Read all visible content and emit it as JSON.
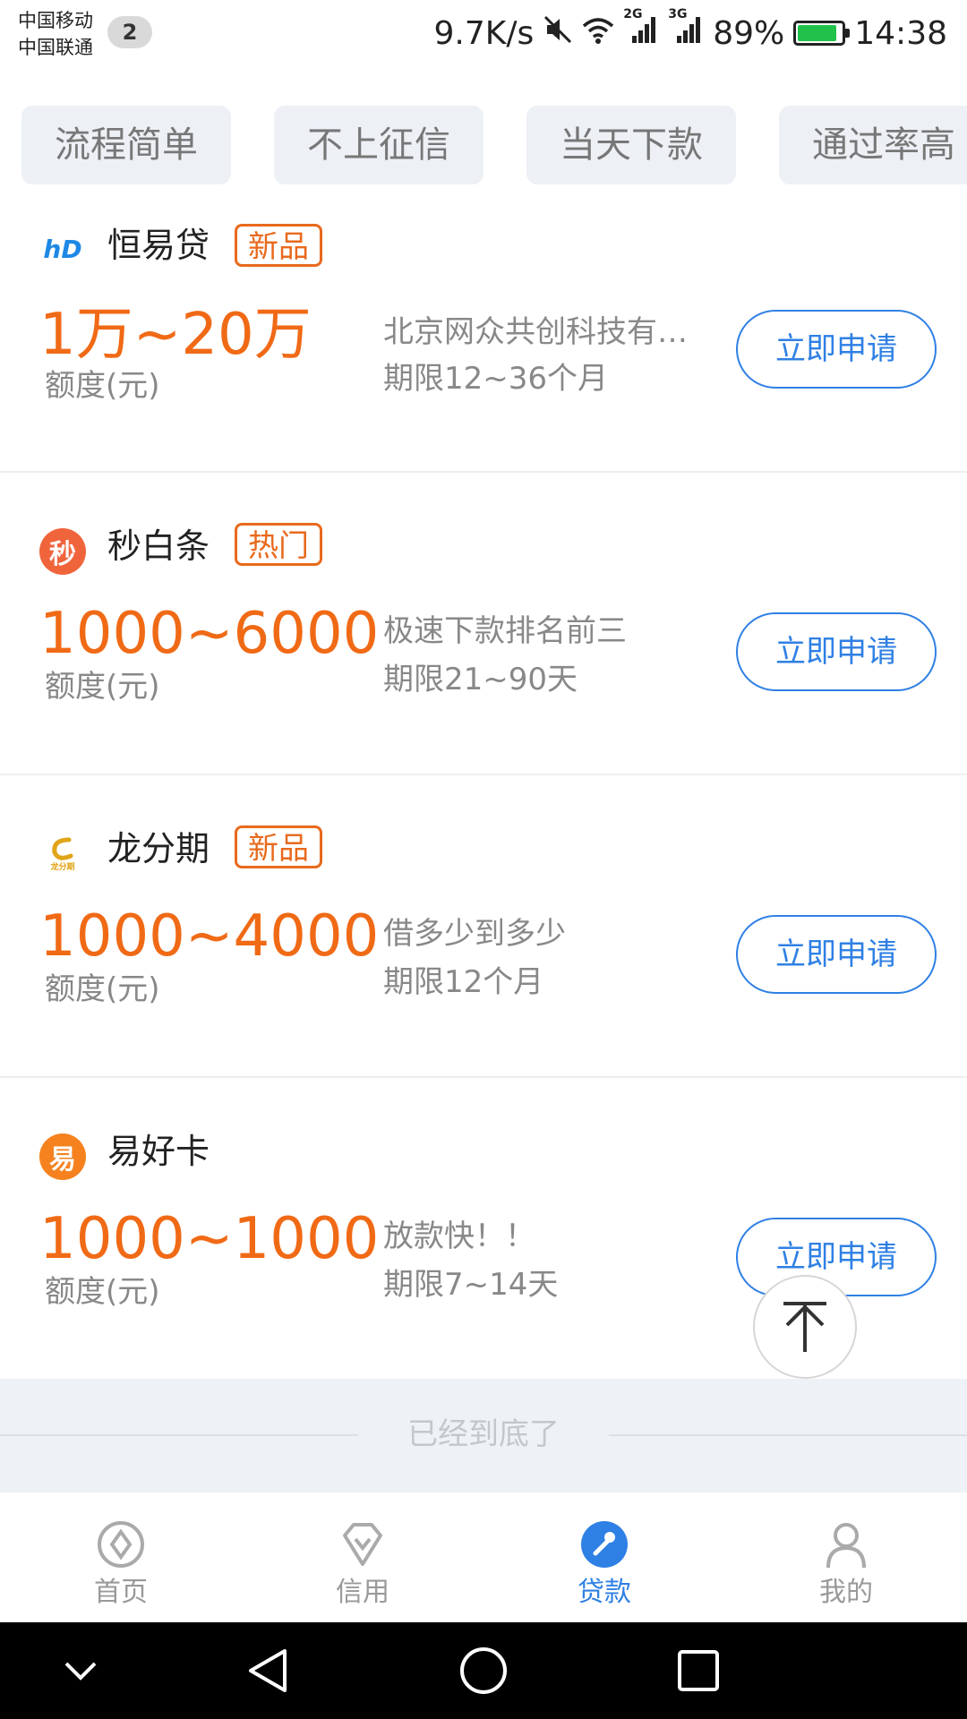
{
  "status_bar": {
    "carrier_1": "中国移动",
    "carrier_2": "中国联通",
    "notification_count": "2",
    "network_speed": "9.7K/s",
    "network_1": "2G",
    "network_2": "3G",
    "battery_percent": "89%",
    "battery_level": 0.89,
    "time": "14:38",
    "icons": [
      "mute-icon",
      "wifi-icon",
      "signal-icon",
      "signal-icon",
      "battery-icon"
    ]
  },
  "tags": [
    {
      "label": "流程简单"
    },
    {
      "label": "不上征信"
    },
    {
      "label": "当天下款"
    },
    {
      "label": "通过率高"
    }
  ],
  "products": [
    {
      "name": "恒易贷",
      "badge": "新品",
      "amount": "1万~20万",
      "amount_label": "额度(元)",
      "desc": "北京网众共创科技有限公司",
      "term": "期限12~36个月",
      "apply_label": "立即申请",
      "logo_text": "hD",
      "logo_color": "#1e88e5"
    },
    {
      "name": "秒白条",
      "badge": "热门",
      "amount": "1000~6000",
      "amount_label": "额度(元)",
      "desc": "极速下款排名前三",
      "term": "期限21~90天",
      "apply_label": "立即申请",
      "logo_text": "秒",
      "logo_color": "#f0643c"
    },
    {
      "name": "龙分期",
      "badge": "新品",
      "amount": "1000~4000",
      "amount_label": "额度(元)",
      "desc": "借多少到多少",
      "term": "期限12个月",
      "apply_label": "立即申请",
      "logo_text": "龙分期",
      "logo_color": "#e0a416"
    },
    {
      "name": "易好卡",
      "badge": "",
      "amount": "1000~1000",
      "amount_label": "额度(元)",
      "desc": "放款快！！",
      "term": "期限7~14天",
      "apply_label": "立即申请",
      "logo_text": "易",
      "logo_color": "#f5821f"
    }
  ],
  "end_notice": "已经到底了",
  "tabbar": [
    {
      "label": "首页",
      "icon": "home-icon",
      "active": false
    },
    {
      "label": "信用",
      "icon": "diamond-icon",
      "active": false
    },
    {
      "label": "贷款",
      "icon": "loan-icon",
      "active": true
    },
    {
      "label": "我的",
      "icon": "user-icon",
      "active": false
    }
  ],
  "colors": {
    "accent": "#2f80e4",
    "amount": "#f06a16",
    "badge": "#e86a1d",
    "tag_bg": "#edf0f5"
  }
}
